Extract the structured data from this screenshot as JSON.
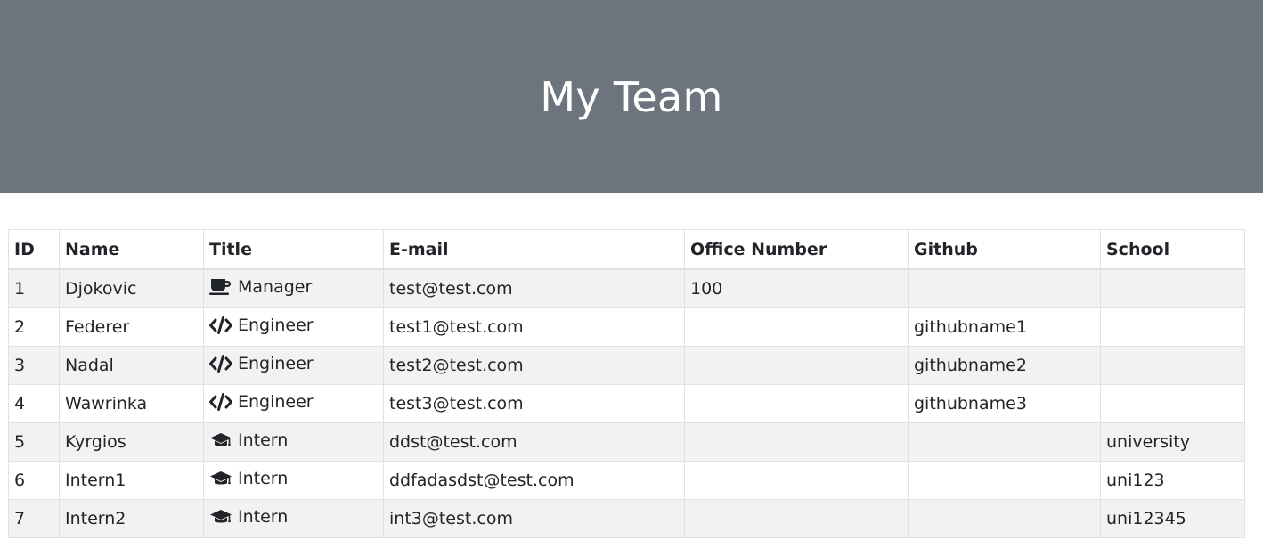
{
  "header": {
    "title": "My Team"
  },
  "table": {
    "columns": [
      "ID",
      "Name",
      "Title",
      "E-mail",
      "Office Number",
      "Github",
      "School"
    ],
    "rows": [
      {
        "id": "1",
        "name": "Djokovic",
        "title": "Manager",
        "icon": "coffee-icon",
        "email": "test@test.com",
        "office": "100",
        "github": "",
        "school": ""
      },
      {
        "id": "2",
        "name": "Federer",
        "title": "Engineer",
        "icon": "code-icon",
        "email": "test1@test.com",
        "office": "",
        "github": "githubname1",
        "school": ""
      },
      {
        "id": "3",
        "name": "Nadal",
        "title": "Engineer",
        "icon": "code-icon",
        "email": "test2@test.com",
        "office": "",
        "github": "githubname2",
        "school": ""
      },
      {
        "id": "4",
        "name": "Wawrinka",
        "title": "Engineer",
        "icon": "code-icon",
        "email": "test3@test.com",
        "office": "",
        "github": "githubname3",
        "school": ""
      },
      {
        "id": "5",
        "name": "Kyrgios",
        "title": "Intern",
        "icon": "graduation-cap-icon",
        "email": "ddst@test.com",
        "office": "",
        "github": "",
        "school": "university"
      },
      {
        "id": "6",
        "name": "Intern1",
        "title": "Intern",
        "icon": "graduation-cap-icon",
        "email": "ddfadasdst@test.com",
        "office": "",
        "github": "",
        "school": "uni123"
      },
      {
        "id": "7",
        "name": "Intern2",
        "title": "Intern",
        "icon": "graduation-cap-icon",
        "email": "int3@test.com",
        "office": "",
        "github": "",
        "school": "uni12345"
      }
    ]
  },
  "colors": {
    "header_bg": "#6c757d",
    "stripe_bg": "#f2f2f2",
    "border": "#dee2e6",
    "text": "#212529"
  }
}
